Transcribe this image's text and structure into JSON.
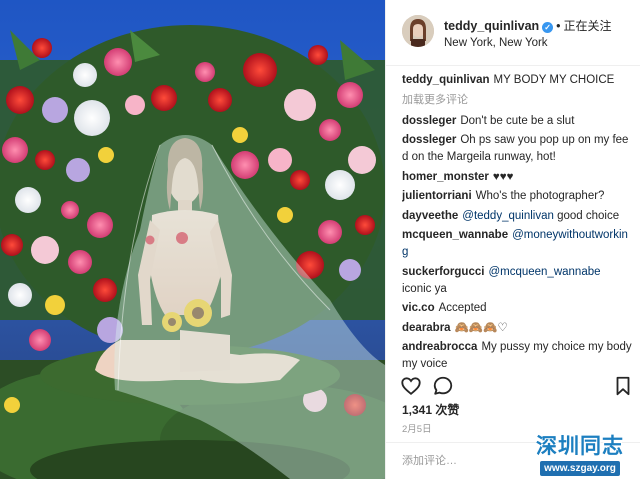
{
  "post": {
    "author": "teddy_quinlivan",
    "follow_state": "正在关注",
    "location": "New York, New York",
    "caption_user": "teddy_quinlivan",
    "caption_text": "MY BODY MY CHOICE",
    "load_more": "加载更多评论",
    "comments": [
      {
        "user": "dossleger",
        "text": "Don't be cute be a slut"
      },
      {
        "user": "dossleger",
        "text": "Oh ps saw you pop up on my feed on the Margeila runway, hot!"
      },
      {
        "user": "homer_monster",
        "text": "♥♥♥"
      },
      {
        "user": "julientorriani",
        "text": "Who's the photographer?"
      },
      {
        "user": "dayveethe",
        "mention": "@teddy_quinlivan",
        "text": " good choice"
      },
      {
        "user": "mcqueen_wannabe",
        "mention": "@moneywithoutworking",
        "text": ""
      },
      {
        "user": "suckerforgucci",
        "mention": "@mcqueen_wannabe",
        "text": " iconic ya"
      },
      {
        "user": "vic.co",
        "text": "Accepted"
      },
      {
        "user": "dearabra",
        "text": "🙈🙈🙈♡"
      },
      {
        "user": "andreabrocca",
        "text": "My pussy my choice my body my voice"
      }
    ],
    "likes": "1,341 次赞",
    "date": "2月5日",
    "add_comment_placeholder": "添加评论…"
  },
  "icons": {
    "like": "heart-icon",
    "comment": "speech-bubble-icon",
    "save": "bookmark-icon",
    "verified": "verified-badge-icon"
  },
  "watermark": {
    "title": "深圳同志",
    "url": "www.szgay.org"
  },
  "colors": {
    "username": "#262626",
    "mention": "#003569",
    "muted": "#999999",
    "verified": "#3897f0",
    "watermark": "#1c7fc0"
  }
}
